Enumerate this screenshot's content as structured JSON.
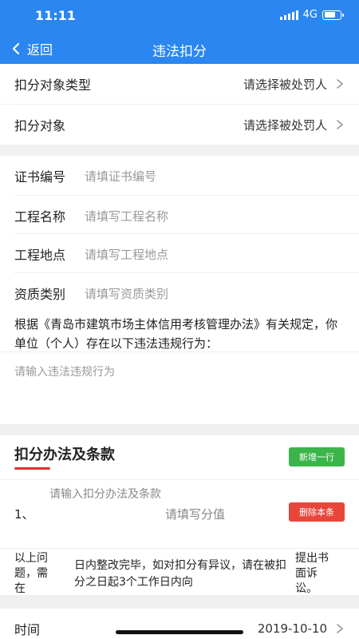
{
  "status": {
    "time": "11:11",
    "network": "4G",
    "signal_icon": "signal-bars-icon",
    "battery_icon": "battery-icon"
  },
  "nav": {
    "back_label": "返回",
    "title": "违法扣分"
  },
  "target_section": {
    "type_label": "扣分对象类型",
    "type_value": "请选择被处罚人",
    "target_label": "扣分对象",
    "target_value": "请选择被处罚人"
  },
  "project": {
    "cert_label": "证书编号",
    "cert_placeholder": "请填证书编号",
    "name_label": "工程名称",
    "name_placeholder": "请填写工程名称",
    "site_label": "工程地点",
    "site_placeholder": "请填写工程地点",
    "qual_label": "资质类别",
    "qual_placeholder": "请填写资质类别"
  },
  "basis_text": "根据《青岛市建筑市场主体信用考核管理办法》有关规定，你单位（个人）存在以下违法违规行为：",
  "violation_placeholder": "请输入违法违规行为",
  "deduction": {
    "title": "扣分办法及条款",
    "add_button": "新增一行",
    "rows": [
      {
        "index": "1、",
        "method_placeholder": "请输入扣分办法及条款",
        "score_placeholder": "请填写分值",
        "delete_button": "删除本条"
      }
    ]
  },
  "notice": {
    "col1": "以上问题，需在",
    "col2": "日内整改完毕，如对扣分有异议，请在被扣分之日起3个工作日内向",
    "col3": "提出书面诉讼。"
  },
  "time": {
    "label": "时间",
    "value": "2019-10-10"
  },
  "colors": {
    "primary": "#2b86f0",
    "add_green": "#3bb54a",
    "delete_red": "#e8463b",
    "accent_red": "#d9342b"
  }
}
